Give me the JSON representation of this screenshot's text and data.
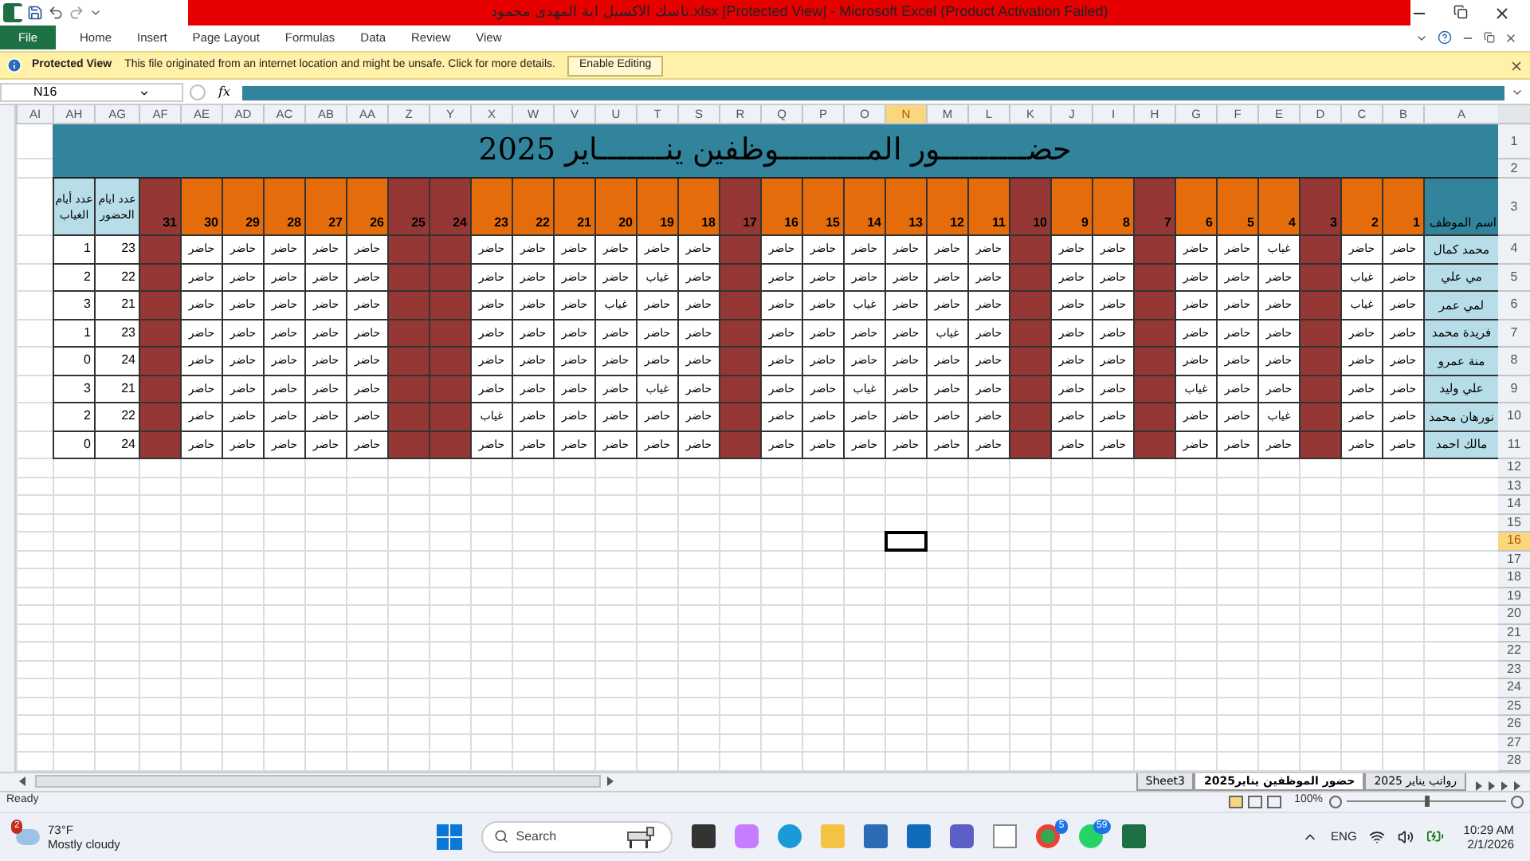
{
  "title_bar": {
    "title": "تاسك الاكسيل اية المهدى محمود.xlsx  [Protected View] - Microsoft Excel (Product Activation Failed)"
  },
  "file_button": {
    "label": "File"
  },
  "menu": {
    "home": "Home",
    "insert": "Insert",
    "page_layout": "Page Layout",
    "formulas": "Formulas",
    "data": "Data",
    "review": "Review",
    "view": "View"
  },
  "protected_view": {
    "label": "Protected View",
    "message": "This file originated from an internet location and might be unsafe. Click for more details.",
    "button": "Enable Editing"
  },
  "formula_bar": {
    "name_box": "N16",
    "fx": "fx"
  },
  "column_headers": [
    {
      "label": "A",
      "selected": false
    },
    {
      "label": "B",
      "selected": false
    },
    {
      "label": "C",
      "selected": false
    },
    {
      "label": "D",
      "selected": false
    },
    {
      "label": "E",
      "selected": false
    },
    {
      "label": "F",
      "selected": false
    },
    {
      "label": "G",
      "selected": false
    },
    {
      "label": "H",
      "selected": false
    },
    {
      "label": "I",
      "selected": false
    },
    {
      "label": "J",
      "selected": false
    },
    {
      "label": "K",
      "selected": false
    },
    {
      "label": "L",
      "selected": false
    },
    {
      "label": "M",
      "selected": false
    },
    {
      "label": "N",
      "selected": true
    },
    {
      "label": "O",
      "selected": false
    },
    {
      "label": "P",
      "selected": false
    },
    {
      "label": "Q",
      "selected": false
    },
    {
      "label": "R",
      "selected": false
    },
    {
      "label": "S",
      "selected": false
    },
    {
      "label": "T",
      "selected": false
    },
    {
      "label": "U",
      "selected": false
    },
    {
      "label": "V",
      "selected": false
    },
    {
      "label": "W",
      "selected": false
    },
    {
      "label": "X",
      "selected": false
    },
    {
      "label": "Y",
      "selected": false
    },
    {
      "label": "Z",
      "selected": false
    },
    {
      "label": "AA",
      "selected": false
    },
    {
      "label": "AB",
      "selected": false
    },
    {
      "label": "AC",
      "selected": false
    },
    {
      "label": "AD",
      "selected": false
    },
    {
      "label": "AE",
      "selected": false
    },
    {
      "label": "AF",
      "selected": false
    },
    {
      "label": "AG",
      "selected": false
    },
    {
      "label": "AH",
      "selected": false
    },
    {
      "label": "AI",
      "selected": false
    }
  ],
  "row_headers": [
    {
      "label": "1",
      "selected": false
    },
    {
      "label": "2",
      "selected": false
    },
    {
      "label": "3",
      "selected": false
    },
    {
      "label": "4",
      "selected": false
    },
    {
      "label": "5",
      "selected": false
    },
    {
      "label": "6",
      "selected": false
    },
    {
      "label": "7",
      "selected": false
    },
    {
      "label": "8",
      "selected": false
    },
    {
      "label": "9",
      "selected": false
    },
    {
      "label": "10",
      "selected": false
    },
    {
      "label": "11",
      "selected": false
    },
    {
      "label": "12",
      "selected": false
    },
    {
      "label": "13",
      "selected": false
    },
    {
      "label": "14",
      "selected": false
    },
    {
      "label": "15",
      "selected": false
    },
    {
      "label": "16",
      "selected": true
    },
    {
      "label": "17",
      "selected": false
    },
    {
      "label": "18",
      "selected": false
    },
    {
      "label": "19",
      "selected": false
    },
    {
      "label": "20",
      "selected": false
    },
    {
      "label": "21",
      "selected": false
    },
    {
      "label": "22",
      "selected": false
    },
    {
      "label": "23",
      "selected": false
    },
    {
      "label": "24",
      "selected": false
    },
    {
      "label": "25",
      "selected": false
    },
    {
      "label": "26",
      "selected": false
    },
    {
      "label": "27",
      "selected": false
    },
    {
      "label": "28",
      "selected": false
    }
  ],
  "sheet": {
    "title": "حضـــــــــور المـــــــــوظفين ينـــــــاير 2025",
    "name_header": "اسم الموظف",
    "present_header": "عدد ايام الحضور",
    "absent_header": "عدد أيام الغياب",
    "days": [
      {
        "label": "1",
        "weekend": false
      },
      {
        "label": "2",
        "weekend": false
      },
      {
        "label": "3",
        "weekend": true
      },
      {
        "label": "4",
        "weekend": false
      },
      {
        "label": "5",
        "weekend": false
      },
      {
        "label": "6",
        "weekend": false
      },
      {
        "label": "7",
        "weekend": true
      },
      {
        "label": "8",
        "weekend": false
      },
      {
        "label": "9",
        "weekend": false
      },
      {
        "label": "10",
        "weekend": true
      },
      {
        "label": "11",
        "weekend": false
      },
      {
        "label": "12",
        "weekend": false
      },
      {
        "label": "13",
        "weekend": false
      },
      {
        "label": "14",
        "weekend": false
      },
      {
        "label": "15",
        "weekend": false
      },
      {
        "label": "16",
        "weekend": false
      },
      {
        "label": "17",
        "weekend": true
      },
      {
        "label": "18",
        "weekend": false
      },
      {
        "label": "19",
        "weekend": false
      },
      {
        "label": "20",
        "weekend": false
      },
      {
        "label": "21",
        "weekend": false
      },
      {
        "label": "22",
        "weekend": false
      },
      {
        "label": "23",
        "weekend": false
      },
      {
        "label": "24",
        "weekend": true
      },
      {
        "label": "25",
        "weekend": true
      },
      {
        "label": "26",
        "weekend": false
      },
      {
        "label": "27",
        "weekend": false
      },
      {
        "label": "28",
        "weekend": false
      },
      {
        "label": "29",
        "weekend": false
      },
      {
        "label": "30",
        "weekend": false
      },
      {
        "label": "31",
        "weekend": true
      }
    ],
    "employees": [
      {
        "name": "محمد كمال",
        "present": "23",
        "absent": "1",
        "cells": [
          "حاضر",
          "حاضر",
          null,
          "غياب",
          "حاضر",
          "حاضر",
          null,
          "حاضر",
          "حاضر",
          null,
          "حاضر",
          "حاضر",
          "حاضر",
          "حاضر",
          "حاضر",
          "حاضر",
          null,
          "حاضر",
          "حاضر",
          "حاضر",
          "حاضر",
          "حاضر",
          "حاضر",
          null,
          null,
          "حاضر",
          "حاضر",
          "حاضر",
          "حاضر",
          "حاضر",
          null
        ]
      },
      {
        "name": "مي علي",
        "present": "22",
        "absent": "2",
        "cells": [
          "حاضر",
          "غياب",
          null,
          "حاضر",
          "حاضر",
          "حاضر",
          null,
          "حاضر",
          "حاضر",
          null,
          "حاضر",
          "حاضر",
          "حاضر",
          "حاضر",
          "حاضر",
          "حاضر",
          null,
          "حاضر",
          "غياب",
          "حاضر",
          "حاضر",
          "حاضر",
          "حاضر",
          null,
          null,
          "حاضر",
          "حاضر",
          "حاضر",
          "حاضر",
          "حاضر",
          null
        ]
      },
      {
        "name": "لمي عمر",
        "present": "21",
        "absent": "3",
        "cells": [
          "حاضر",
          "غياب",
          null,
          "حاضر",
          "حاضر",
          "حاضر",
          null,
          "حاضر",
          "حاضر",
          null,
          "حاضر",
          "حاضر",
          "حاضر",
          "غياب",
          "حاضر",
          "حاضر",
          null,
          "حاضر",
          "حاضر",
          "غياب",
          "حاضر",
          "حاضر",
          "حاضر",
          null,
          null,
          "حاضر",
          "حاضر",
          "حاضر",
          "حاضر",
          "حاضر",
          null
        ]
      },
      {
        "name": "فريدة محمد",
        "present": "23",
        "absent": "1",
        "cells": [
          "حاضر",
          "حاضر",
          null,
          "حاضر",
          "حاضر",
          "حاضر",
          null,
          "حاضر",
          "حاضر",
          null,
          "حاضر",
          "غياب",
          "حاضر",
          "حاضر",
          "حاضر",
          "حاضر",
          null,
          "حاضر",
          "حاضر",
          "حاضر",
          "حاضر",
          "حاضر",
          "حاضر",
          null,
          null,
          "حاضر",
          "حاضر",
          "حاضر",
          "حاضر",
          "حاضر",
          null
        ]
      },
      {
        "name": "منة عمرو",
        "present": "24",
        "absent": "0",
        "cells": [
          "حاضر",
          "حاضر",
          null,
          "حاضر",
          "حاضر",
          "حاضر",
          null,
          "حاضر",
          "حاضر",
          null,
          "حاضر",
          "حاضر",
          "حاضر",
          "حاضر",
          "حاضر",
          "حاضر",
          null,
          "حاضر",
          "حاضر",
          "حاضر",
          "حاضر",
          "حاضر",
          "حاضر",
          null,
          null,
          "حاضر",
          "حاضر",
          "حاضر",
          "حاضر",
          "حاضر",
          null
        ]
      },
      {
        "name": "علي وليد",
        "present": "21",
        "absent": "3",
        "cells": [
          "حاضر",
          "حاضر",
          null,
          "حاضر",
          "حاضر",
          "غياب",
          null,
          "حاضر",
          "حاضر",
          null,
          "حاضر",
          "حاضر",
          "حاضر",
          "غياب",
          "حاضر",
          "حاضر",
          null,
          "حاضر",
          "غياب",
          "حاضر",
          "حاضر",
          "حاضر",
          "حاضر",
          null,
          null,
          "حاضر",
          "حاضر",
          "حاضر",
          "حاضر",
          "حاضر",
          null
        ]
      },
      {
        "name": "نورهان محمد",
        "present": "22",
        "absent": "2",
        "cells": [
          "حاضر",
          "حاضر",
          null,
          "غياب",
          "حاضر",
          "حاضر",
          null,
          "حاضر",
          "حاضر",
          null,
          "حاضر",
          "حاضر",
          "حاضر",
          "حاضر",
          "حاضر",
          "حاضر",
          null,
          "حاضر",
          "حاضر",
          "حاضر",
          "حاضر",
          "حاضر",
          "غياب",
          null,
          null,
          "حاضر",
          "حاضر",
          "حاضر",
          "حاضر",
          "حاضر",
          null
        ]
      },
      {
        "name": "مالك احمد",
        "present": "24",
        "absent": "0",
        "cells": [
          "حاضر",
          "حاضر",
          null,
          "حاضر",
          "حاضر",
          "حاضر",
          null,
          "حاضر",
          "حاضر",
          null,
          "حاضر",
          "حاضر",
          "حاضر",
          "حاضر",
          "حاضر",
          "حاضر",
          null,
          "حاضر",
          "حاضر",
          "حاضر",
          "حاضر",
          "حاضر",
          "حاضر",
          null,
          null,
          "حاضر",
          "حاضر",
          "حاضر",
          "حاضر",
          "حاضر",
          null
        ]
      }
    ]
  },
  "sheet_tabs": [
    {
      "label": "رواتب يناير 2025",
      "selected": false
    },
    {
      "label": "حضور الموظفين يناير2025",
      "selected": true
    },
    {
      "label": "Sheet3",
      "selected": false
    }
  ],
  "status_bar": {
    "status": "Ready",
    "zoom": "100%",
    "zoom_slider": {
      "level": 0.5
    }
  },
  "taskbar": {
    "weather_badge": "2",
    "temperature": "73°F",
    "weather": "Mostly cloudy",
    "search": "Search",
    "chrome_badge": "5",
    "whatsapp_badge": "59",
    "language": "ENG",
    "time": "10:29 AM",
    "date": "2/1/2026"
  }
}
